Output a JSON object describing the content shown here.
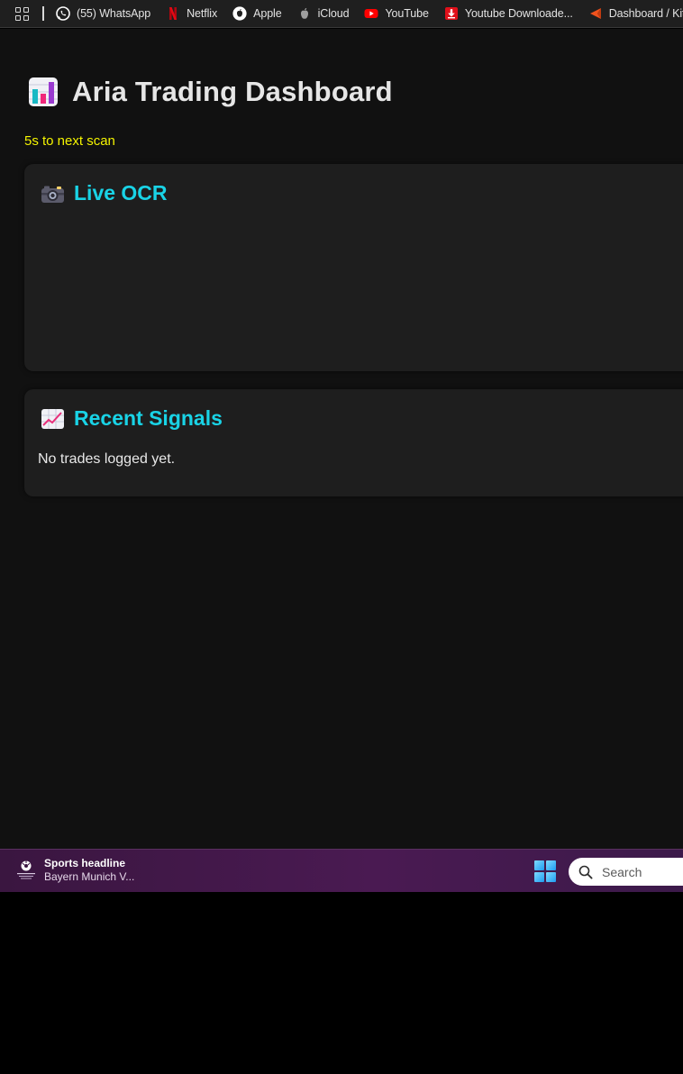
{
  "bookmarks": {
    "items": [
      {
        "label": "(55) WhatsApp",
        "icon": "whatsapp-icon"
      },
      {
        "label": "Netflix",
        "icon": "netflix-icon"
      },
      {
        "label": "Apple",
        "icon": "apple-icon"
      },
      {
        "label": "iCloud",
        "icon": "icloud-apple-icon"
      },
      {
        "label": "YouTube",
        "icon": "youtube-icon"
      },
      {
        "label": "Youtube Downloade...",
        "icon": "download-icon"
      },
      {
        "label": "Dashboard / Kite",
        "icon": "kite-icon"
      }
    ]
  },
  "dashboard": {
    "title": "Aria Trading Dashboard",
    "title_icon": "bar-chart-icon",
    "scan_status": "5s to next scan"
  },
  "cards": {
    "ocr": {
      "title": "Live OCR",
      "icon": "camera-icon"
    },
    "signals": {
      "title": "Recent Signals",
      "icon": "chart-increasing-icon",
      "empty_text": "No trades logged yet."
    }
  },
  "taskbar": {
    "widget_title": "Sports headline",
    "widget_subtitle": "Bayern Munich V...",
    "search_placeholder": "Search"
  },
  "colors": {
    "page_background": "#111111",
    "card_background": "#1e1e1e",
    "card_title": "#19d3e6",
    "scan_status": "#f4f400",
    "title_text": "#e6e6e6"
  }
}
